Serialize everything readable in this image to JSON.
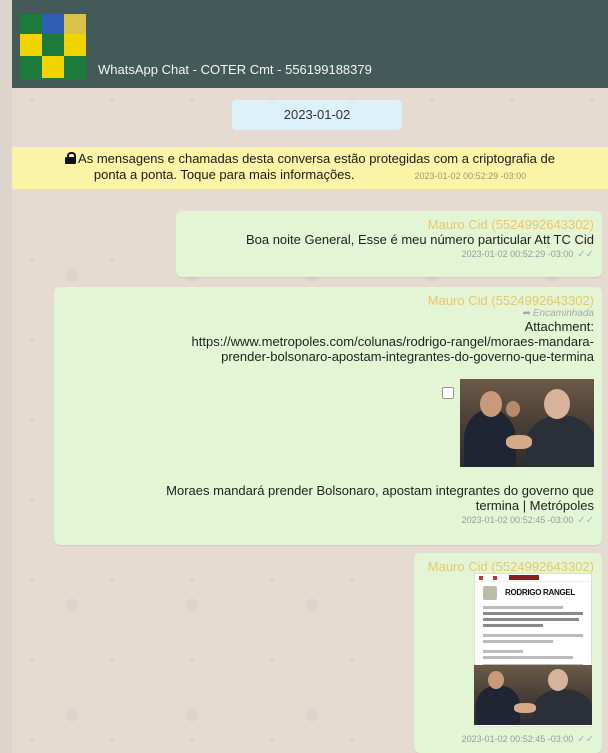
{
  "header": {
    "title": "WhatsApp Chat - COTER Cmt - 556199188379",
    "brand_colors": {
      "green": "#1c7a3a",
      "yellow": "#f2d500",
      "header_bg": "#445a58"
    }
  },
  "date_pill": "2023-01-02",
  "encryption_notice": {
    "line1": "As mensagens e chamadas desta conversa estão protegidas com a criptografia de",
    "line2": "ponta a ponta. Toque para mais informações.",
    "timestamp": "2023-01-02 00:52:29 -03:00",
    "icon": "lock-icon"
  },
  "messages": [
    {
      "sender": "Mauro Cid (5524992643302)",
      "text": "Boa noite General, Esse é meu número particular Att TC Cid",
      "timestamp": "2023-01-02 00:52:29 -03:00"
    },
    {
      "sender": "Mauro Cid (5524992643302)",
      "forwarded_label": "Encaminhada",
      "attachment_label": "Attachment:",
      "attachment_url_line1": "https://www.metropoles.com/colunas/rodrigo-rangel/moraes-mandara-",
      "attachment_url_line2": "prender-bolsonaro-apostam-integrantes-do-governo-que-termina",
      "caption_line1": "Moraes mandará prender Bolsonaro, apostam integrantes do governo que",
      "caption_line2": "termina | Metrópoles",
      "timestamp": "2023-01-02 00:52:45 -03:00"
    },
    {
      "sender": "Mauro Cid (5524992643302)",
      "thumbnail_title": "RODRIGO RANGEL",
      "timestamp": "2023-01-02 00:52:45 -03:00"
    }
  ]
}
